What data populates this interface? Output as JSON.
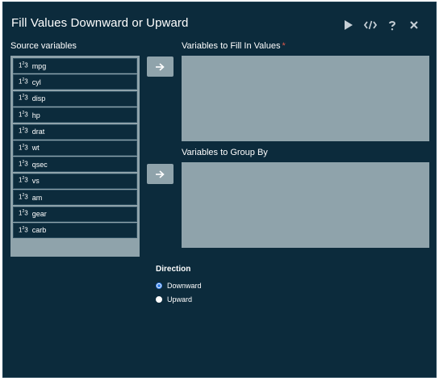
{
  "dialog": {
    "title": "Fill Values Downward or Upward",
    "toolbar": [
      {
        "name": "run-icon"
      },
      {
        "name": "code-icon"
      },
      {
        "name": "help-icon"
      },
      {
        "name": "close-icon"
      }
    ]
  },
  "source": {
    "label": "Source variables",
    "icon_text": "123",
    "items": [
      "mpg",
      "cyl",
      "disp",
      "hp",
      "drat",
      "wt",
      "qsec",
      "vs",
      "am",
      "gear",
      "carb"
    ]
  },
  "fill_target": {
    "label": "Variables to Fill In Values",
    "required_mark": "*"
  },
  "group_target": {
    "label": "Variables to Group By"
  },
  "direction": {
    "label": "Direction",
    "options": [
      {
        "label": "Downward",
        "checked": true
      },
      {
        "label": "Upward",
        "checked": false
      }
    ]
  },
  "colors": {
    "background": "#0c2b3c",
    "panel": "#8fa3ab",
    "radio_accent": "#2f7ce6",
    "required": "#e0584a"
  }
}
